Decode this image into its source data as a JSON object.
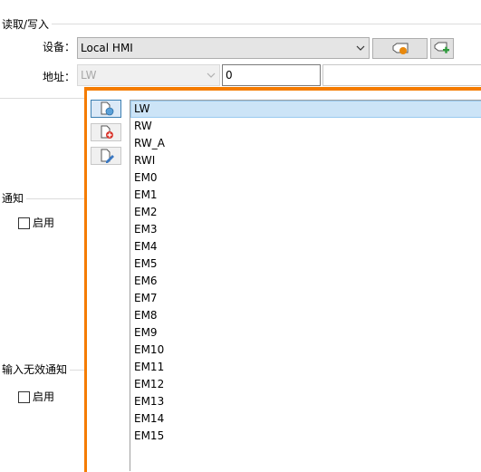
{
  "read_write_section": {
    "title": "读取/写入",
    "device_label": "设备：",
    "device_value": "Local HMI",
    "address_label": "地址：",
    "address_value": "LW",
    "address_number": "0"
  },
  "notify_section": {
    "title": "通知",
    "enable_label": "启用",
    "enabled": false
  },
  "invalid_input_section": {
    "title": "输入无效通知",
    "enable_label": "启用",
    "enabled": false
  },
  "popup": {
    "tools": [
      "tag-library-icon",
      "tag-add-icon",
      "tag-edit-icon"
    ],
    "items": [
      "LW",
      "RW",
      "RW_A",
      "RWI",
      "EM0",
      "EM1",
      "EM2",
      "EM3",
      "EM4",
      "EM5",
      "EM6",
      "EM7",
      "EM8",
      "EM9",
      "EM10",
      "EM11",
      "EM12",
      "EM13",
      "EM14",
      "EM15"
    ],
    "selected_index": 0
  },
  "colors": {
    "popup_border": "#f57c00",
    "selection_bg": "#cce4f7",
    "green_plus": "#2e9a3c",
    "orange_dot": "#e8880c"
  }
}
